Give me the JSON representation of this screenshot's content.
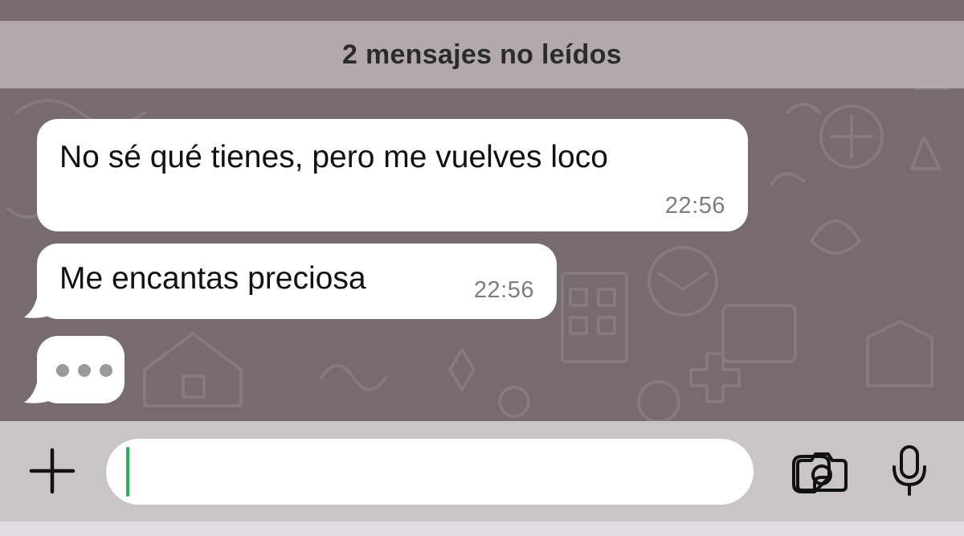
{
  "banner": {
    "unread_label": "2 mensajes no leídos"
  },
  "messages": [
    {
      "text": "No sé qué tienes, pero me vuelves loco",
      "time": "22:56"
    },
    {
      "text": "Me encantas preciosa",
      "time": "22:56"
    }
  ],
  "typing_indicator": {
    "dots": 3
  },
  "composer": {
    "value": "",
    "icons": {
      "add": "plus-icon",
      "sticker": "sticker-icon",
      "camera": "camera-icon",
      "microphone": "microphone-icon"
    }
  },
  "colors": {
    "wallpaper": "#776b6d",
    "banner": "#b3a9ab",
    "bubble": "#ffffff",
    "input_bar": "#c9c5c6",
    "caret": "#25b35a"
  }
}
